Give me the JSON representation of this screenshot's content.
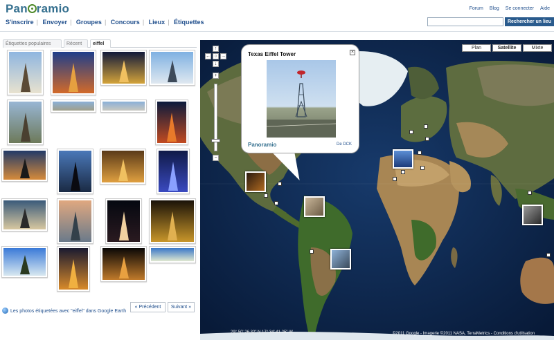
{
  "header": {
    "logo": "Panoramio",
    "nav": [
      "S'inscrire",
      "Envoyer",
      "Groupes",
      "Concours",
      "Lieux",
      "Étiquettes"
    ],
    "top_links": [
      "Forum",
      "Blog",
      "Se connecter",
      "Aide"
    ],
    "search_placeholder": "",
    "search_button": "Rechercher un lieu"
  },
  "tabs": [
    {
      "label": "Étiquettes populaires",
      "active": false
    },
    {
      "label": "Récent",
      "active": false
    },
    {
      "label": "eiffel",
      "active": true
    }
  ],
  "footer": {
    "google_earth_link": "Les photos étiquetées avec \"eiffel\" dans Google Earth",
    "prev": "« Précédent",
    "next": "Suivant »"
  },
  "map": {
    "types": [
      {
        "label": "Plan",
        "active": false
      },
      {
        "label": "Satellite",
        "active": true
      },
      {
        "label": "Mixte",
        "active": false
      }
    ],
    "coords": "29° 50' 26.32\" N 17° 34' 41.25\" W",
    "copyright": "©2011 Google - Imagerie ©2011 NASA, TerraMetrics - Conditions d'utilisation",
    "popup": {
      "title": "Texas Eiffel Tower",
      "brand": "Panoramio",
      "author": "De DCK"
    }
  },
  "colors": {
    "brand_blue": "#35708f",
    "nav_blue": "#1f4e8c",
    "button_blue": "#2a5b8d",
    "ocean": "#0c2246"
  }
}
